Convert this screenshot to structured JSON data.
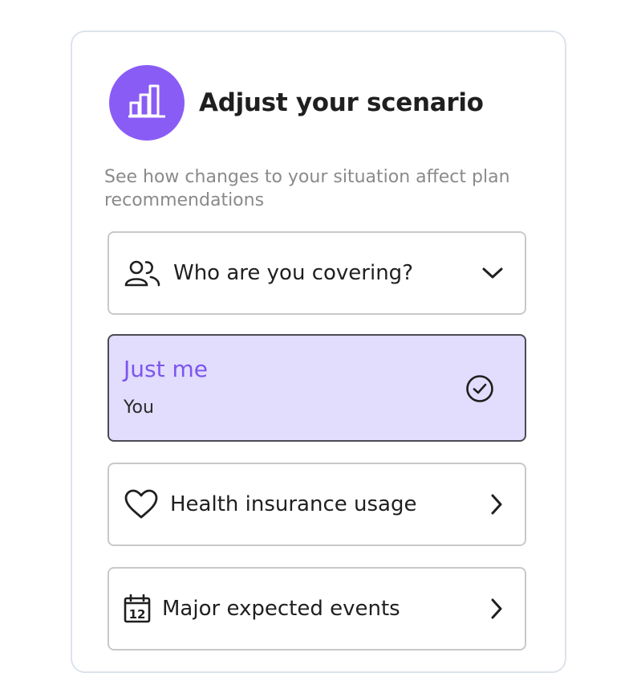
{
  "scenario": {
    "title": "Adjust your scenario",
    "subtitle": "See how changes to your situation affect plan recommendations",
    "header_icon": "bar-chart-icon",
    "accent_color": "#8a5cf6"
  },
  "covering": {
    "label": "Who are you covering?",
    "icon": "users-icon",
    "chevron": "chevron-down-icon",
    "selected_option": {
      "title": "Just me",
      "subtitle": "You",
      "icon": "check-circle-icon",
      "background": "#e2dcfd"
    }
  },
  "usage": {
    "label": "Health insurance usage",
    "icon": "heart-icon",
    "chevron": "chevron-right-icon"
  },
  "events": {
    "label": "Major expected events",
    "icon": "calendar-icon",
    "calendar_day": "12",
    "chevron": "chevron-right-icon"
  }
}
